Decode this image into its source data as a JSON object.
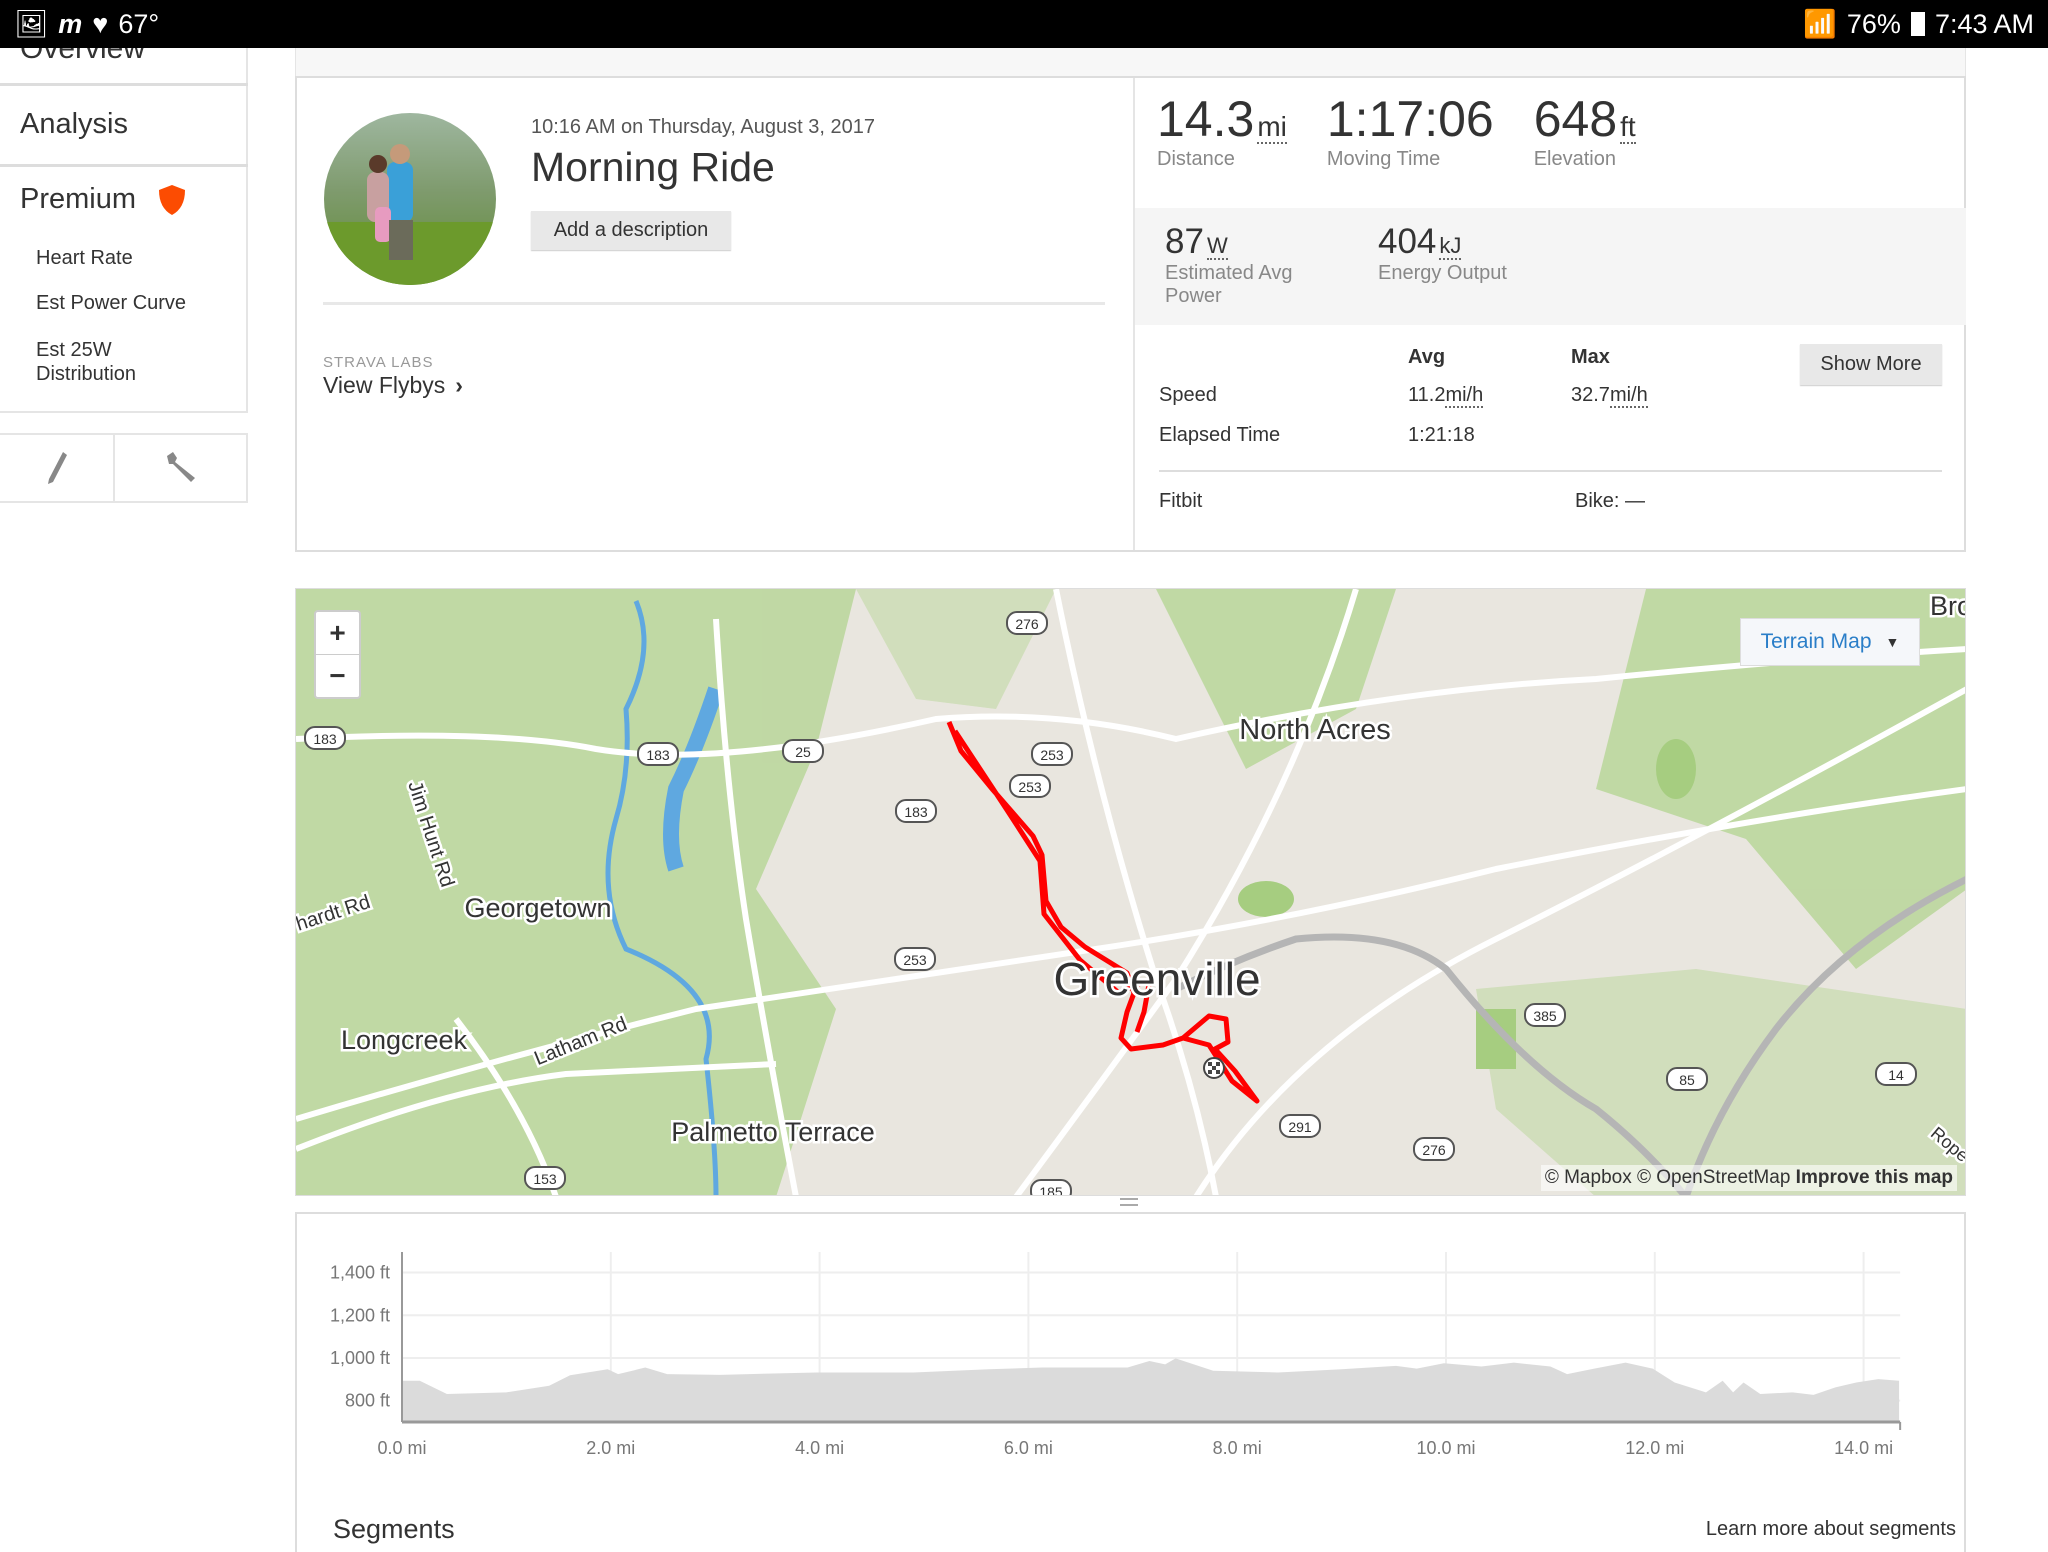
{
  "status_bar": {
    "temperature": "67°",
    "battery": "76%",
    "time": "7:43 AM"
  },
  "sidebar": {
    "overview": "Overview",
    "analysis": "Analysis",
    "premium": "Premium",
    "premium_items": [
      "Heart Rate",
      "Est Power Curve",
      "Est 25W Distribution"
    ],
    "premium_color": "#fc4c02"
  },
  "activity": {
    "datetime": "10:16 AM on Thursday, August 3, 2017",
    "title": "Morning Ride",
    "add_description": "Add a description",
    "labs_label": "STRAVA LABS",
    "view_flybys": "View Flybys"
  },
  "stats": {
    "primary": [
      {
        "value": "14.3",
        "unit": "mi",
        "label": "Distance"
      },
      {
        "value": "1:17:06",
        "unit": "",
        "label": "Moving Time"
      },
      {
        "value": "648",
        "unit": "ft",
        "label": "Elevation"
      }
    ],
    "secondary": [
      {
        "value": "87",
        "unit": "W",
        "label": "Estimated Avg Power"
      },
      {
        "value": "404",
        "unit": "kJ",
        "label": "Energy Output"
      }
    ],
    "table": {
      "col_avg": "Avg",
      "col_max": "Max",
      "show_more": "Show More",
      "rows": [
        {
          "label": "Speed",
          "avg": "11.2",
          "avg_unit": "mi/h",
          "max": "32.7",
          "max_unit": "mi/h"
        },
        {
          "label": "Elapsed Time",
          "avg": "1:21:18"
        }
      ]
    },
    "device": "Fitbit",
    "bike": "Bike: —"
  },
  "map": {
    "style_selector": "Terrain Map",
    "zoom_in": "+",
    "zoom_out": "−",
    "attribution": "© Mapbox © OpenStreetMap",
    "improve": "Improve this map",
    "route_color": "#ff0000",
    "places": [
      "North Acres",
      "Georgetown",
      "Greenville",
      "Longcreek",
      "Palmetto Terrace",
      "Latham Rd",
      "Jim Hunt Rd",
      "hardt Rd",
      "Bro",
      "Rope"
    ],
    "shields": [
      "276",
      "183",
      "183",
      "25",
      "253",
      "253",
      "183",
      "253",
      "385",
      "85",
      "14",
      "291",
      "276",
      "153",
      "185"
    ]
  },
  "chart_data": {
    "type": "area",
    "xlabel": "",
    "ylabel": "",
    "xlim": [
      0,
      14.35
    ],
    "ylim": [
      700,
      1500
    ],
    "x_ticks": [
      "0.0 mi",
      "2.0 mi",
      "4.0 mi",
      "6.0 mi",
      "8.0 mi",
      "10.0 mi",
      "12.0 mi",
      "14.0 mi"
    ],
    "y_ticks": [
      "1,400 ft",
      "1,200 ft",
      "1,000 ft",
      "800 ft"
    ],
    "grid": true,
    "fill_color": "#d9d9d9",
    "x": [
      0,
      0.17,
      0.43,
      1.0,
      1.41,
      1.61,
      1.97,
      2.07,
      2.33,
      2.54,
      3.05,
      3.97,
      4.9,
      5.62,
      6.13,
      6.95,
      7.16,
      7.31,
      7.41,
      7.77,
      8.39,
      9.0,
      9.52,
      9.72,
      9.98,
      10.34,
      10.65,
      11.0,
      11.16,
      11.42,
      11.72,
      11.98,
      12.19,
      12.49,
      12.65,
      12.75,
      12.85,
      13.01,
      13.32,
      13.52,
      13.73,
      13.93,
      14.14,
      14.34
    ],
    "y": [
      893,
      893,
      831,
      839,
      870,
      919,
      947,
      924,
      955,
      924,
      921,
      932,
      932,
      947,
      955,
      955,
      986,
      970,
      998,
      940,
      932,
      947,
      963,
      950,
      975,
      960,
      978,
      960,
      924,
      950,
      978,
      950,
      885,
      839,
      893,
      839,
      885,
      831,
      839,
      827,
      862,
      885,
      901,
      893
    ]
  },
  "segments": {
    "title": "Segments",
    "learn_more": "Learn more about segments"
  }
}
